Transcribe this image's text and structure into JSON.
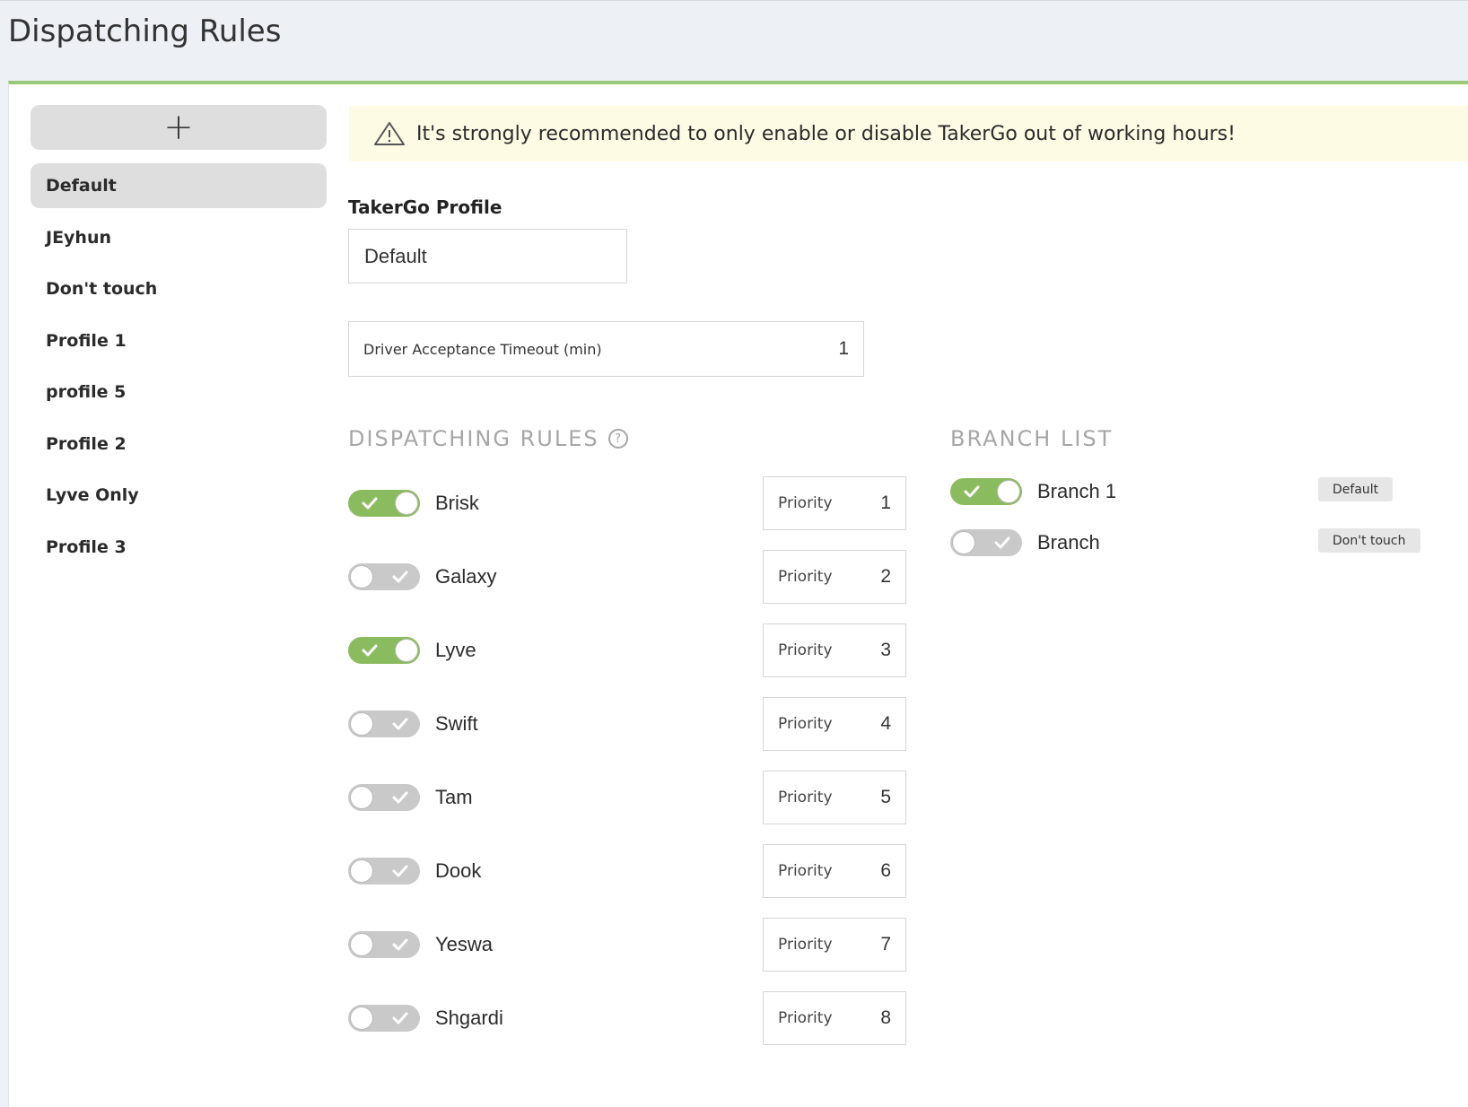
{
  "page": {
    "title": "Dispatching Rules"
  },
  "sidebar": {
    "add_icon": "plus-icon",
    "profiles": [
      {
        "label": "Default",
        "active": true
      },
      {
        "label": "JEyhun",
        "active": false
      },
      {
        "label": "Don't touch",
        "active": false
      },
      {
        "label": "Profile 1",
        "active": false
      },
      {
        "label": "profile 5",
        "active": false
      },
      {
        "label": "Profile 2",
        "active": false
      },
      {
        "label": "Lyve Only",
        "active": false
      },
      {
        "label": "Profile 3",
        "active": false
      }
    ]
  },
  "banner": {
    "icon": "warning-triangle-icon",
    "text": "It's strongly recommended to only enable or disable TakerGo out of working hours!"
  },
  "profile_field": {
    "label": "TakerGo Profile",
    "value": "Default"
  },
  "timeout_field": {
    "label": "Driver Acceptance Timeout (min)",
    "value": "1"
  },
  "dispatching": {
    "title": "DISPATCHING RULES",
    "help_icon": "question-circle-icon",
    "priority_label": "Priority",
    "rules": [
      {
        "name": "Brisk",
        "enabled": true,
        "priority": "1"
      },
      {
        "name": "Galaxy",
        "enabled": false,
        "priority": "2"
      },
      {
        "name": "Lyve",
        "enabled": true,
        "priority": "3"
      },
      {
        "name": "Swift",
        "enabled": false,
        "priority": "4"
      },
      {
        "name": "Tam",
        "enabled": false,
        "priority": "5"
      },
      {
        "name": "Dook",
        "enabled": false,
        "priority": "6"
      },
      {
        "name": "Yeswa",
        "enabled": false,
        "priority": "7"
      },
      {
        "name": "Shgardi",
        "enabled": false,
        "priority": "8"
      }
    ]
  },
  "branches": {
    "title": "BRANCH LIST",
    "items": [
      {
        "name": "Branch 1",
        "enabled": true,
        "badge": "Default"
      },
      {
        "name": "Branch",
        "enabled": false,
        "badge": "Don't touch"
      }
    ]
  },
  "colors": {
    "accent_green": "#8bbb5f",
    "banner_bg": "#fdfbe4",
    "toggle_off": "#c9c9c9"
  }
}
